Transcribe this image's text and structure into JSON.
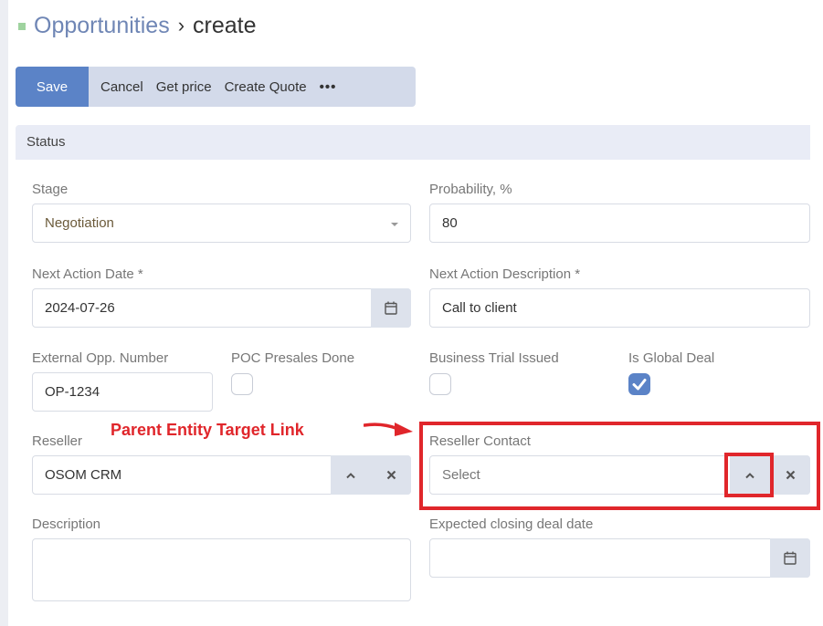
{
  "breadcrumb": {
    "parent": "Opportunities",
    "separator": "›",
    "current": "create"
  },
  "toolbar": {
    "save": "Save",
    "cancel": "Cancel",
    "get_price": "Get price",
    "create_quote": "Create Quote",
    "more": "•••"
  },
  "section": {
    "title": "Status"
  },
  "fields": {
    "stage": {
      "label": "Stage",
      "value": "Negotiation"
    },
    "probability": {
      "label": "Probability, %",
      "value": "80"
    },
    "next_action_date": {
      "label": "Next Action Date *",
      "value": "2024-07-26"
    },
    "next_action_description": {
      "label": "Next Action Description *",
      "value": "Call to client"
    },
    "external_opp_number": {
      "label": "External Opp. Number",
      "value": "OP-1234"
    },
    "poc_presales_done": {
      "label": "POC Presales Done",
      "checked": false
    },
    "business_trial_issued": {
      "label": "Business Trial Issued",
      "checked": false
    },
    "is_global_deal": {
      "label": "Is Global Deal",
      "checked": true
    },
    "reseller": {
      "label": "Reseller",
      "value": "OSOM CRM"
    },
    "reseller_contact": {
      "label": "Reseller Contact",
      "placeholder": "Select"
    },
    "description": {
      "label": "Description",
      "value": ""
    },
    "expected_closing_deal_date": {
      "label": "Expected closing deal date",
      "value": ""
    }
  },
  "annotation": {
    "text": "Parent Entity Target Link",
    "color": "#e0262b"
  },
  "colors": {
    "primary": "#5b83c7",
    "toolbar_bg": "#d3daea",
    "section_bg": "#e9ecf6",
    "addon_bg": "#dde2ec",
    "breadcrumb_link": "#6f86b5",
    "bullet": "#9fd39f"
  },
  "icons": {
    "calendar": "calendar-icon",
    "chevron_up": "chevron-up-icon",
    "clear": "close-icon",
    "check": "check-icon",
    "dropdown": "caret-down-icon"
  }
}
